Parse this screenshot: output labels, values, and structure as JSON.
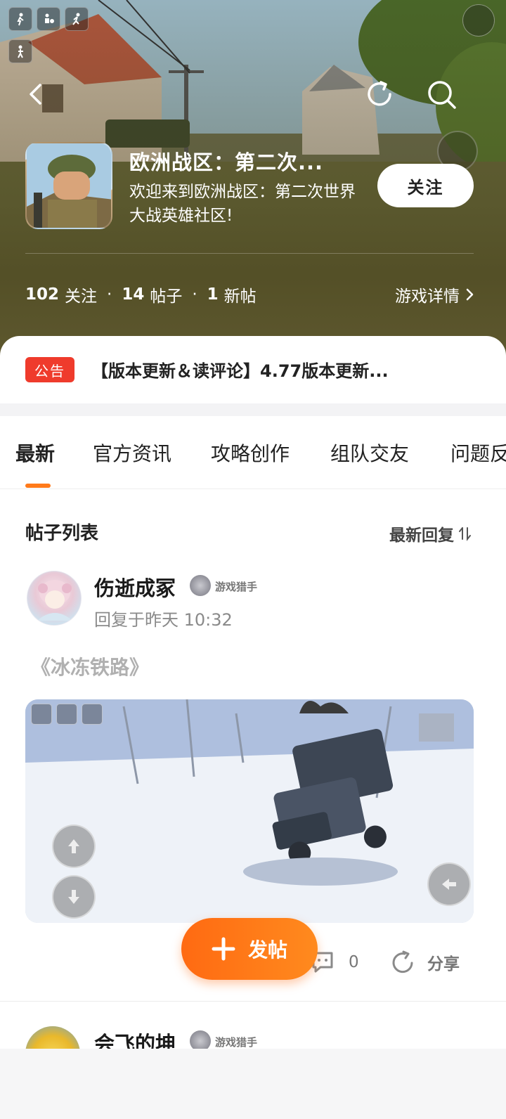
{
  "header": {
    "game_title": "欧洲战区：第二次...",
    "game_description": "欢迎来到欧洲战区：第二次世界大战英雄社区!",
    "follow_label": "关注",
    "stats": {
      "followers_num": "102",
      "followers_label": "关注",
      "posts_num": "14",
      "posts_label": "帖子",
      "new_num": "1",
      "new_label": "新帖",
      "separator": "·"
    },
    "game_detail_label": "游戏详情"
  },
  "notice": {
    "tag": "公告",
    "text": "【版本更新＆读评论】4.77版本更新..."
  },
  "tabs": [
    {
      "label": "最新"
    },
    {
      "label": "官方资讯"
    },
    {
      "label": "攻略创作"
    },
    {
      "label": "组队交友"
    },
    {
      "label": "问题反馈"
    }
  ],
  "list": {
    "title": "帖子列表",
    "sort_label": "最新回复"
  },
  "posts": [
    {
      "author": "伤逝成冢",
      "badge": "游戏猎手",
      "reply_time": "回复于昨天 10:32",
      "title": "《冰冻铁路》",
      "comments": "0",
      "share_label": "分享"
    },
    {
      "author": "会飞的坤",
      "badge": "游戏猎手"
    }
  ],
  "fab": {
    "label": "发帖"
  },
  "colors": {
    "accent": "#ff7a1a",
    "notice_tag": "#ef3b2c",
    "hero_bg": "#5e582f"
  }
}
